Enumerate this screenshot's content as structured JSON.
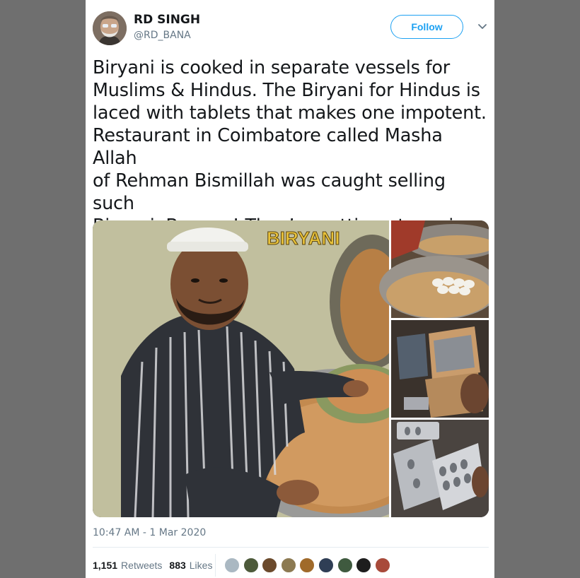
{
  "tweet": {
    "author_name": "RD SINGH",
    "author_handle": "@RD_BANA",
    "follow_label": "Follow",
    "text": "Biryani is cooked in separate vessels for\nMuslims & Hindus. The Biryani for Hindus is\nlaced with tablets that makes one impotent.\nRestaurant in Coimbatore called Masha Allah\nof Rehman Bismillah was caught selling such\nBiryani. Beware! They’re getting at you in\nevery possible way.",
    "timestamp": "10:47 AM - 1 Mar 2020",
    "retweets_count": "1,151",
    "retweets_label": "Retweets",
    "likes_count": "883",
    "likes_label": "Likes"
  },
  "media": {
    "main_photo_caption": "BIRYANI"
  },
  "icons": {
    "menu_caret": "chevron-down-icon"
  },
  "colors": {
    "accent": "#1da1f2",
    "secondary_text": "#657786",
    "primary_text": "#14171a",
    "backdrop": "#6f6f6f"
  },
  "likers": [
    {
      "color": "#aab8c2"
    },
    {
      "color": "#4d5a3a"
    },
    {
      "color": "#6b4a2c"
    },
    {
      "color": "#8c7a52"
    },
    {
      "color": "#a06a2a"
    },
    {
      "color": "#2f3e55"
    },
    {
      "color": "#3f5a3f"
    },
    {
      "color": "#1d1d1d"
    },
    {
      "color": "#a84a3a"
    }
  ]
}
